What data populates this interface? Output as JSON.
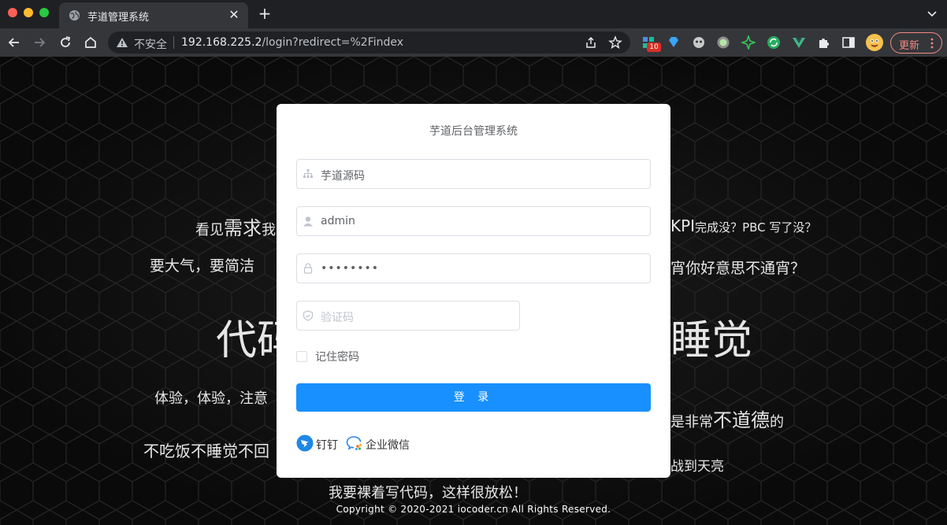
{
  "browser": {
    "tab_title": "芋道管理系统",
    "tab_close": "✕",
    "new_tab": "+",
    "security_label": "不安全",
    "url_host": "192.168.225.2",
    "url_path": "/login?redirect=%2Findex",
    "extension_badge": "10",
    "update_label": "更新"
  },
  "background": {
    "lines": [
      {
        "segments": [
          "看见",
          "需求",
          "我"
        ]
      },
      {
        "segments": [
          "KPI",
          "完成没？PBC 写了没？"
        ]
      },
      {
        "segments": [
          "要大气，要简洁"
        ]
      },
      {
        "segments": [
          "宵你好意思不通宵？"
        ]
      },
      {
        "segments": [
          "代码"
        ]
      },
      {
        "segments": [
          "睡觉"
        ]
      },
      {
        "segments": [
          "体验，体验，注意"
        ]
      },
      {
        "segments": [
          "是非常",
          "不道德",
          "的"
        ]
      },
      {
        "segments": [
          "不吃饭不睡觉不回"
        ]
      },
      {
        "segments": [
          "战到天亮"
        ]
      },
      {
        "segments": [
          "我要裸着写代码，这样很放松！"
        ]
      }
    ]
  },
  "login": {
    "title": "芋道后台管理系统",
    "tenant_value": "芋道源码",
    "username_value": "admin",
    "password_value": "••••••••",
    "captcha_placeholder": "验证码",
    "remember_label": "记住密码",
    "login_button": "登 录",
    "social": [
      {
        "label": "钉钉"
      },
      {
        "label": "企业微信"
      }
    ]
  },
  "footer": {
    "copyright": "Copyright © 2020-2021 iocoder.cn All Rights Reserved."
  },
  "colors": {
    "primary": "#1890ff",
    "chrome_dark": "#1f2023",
    "chrome_toolbar": "#35363a",
    "update_accent": "#f28b82"
  }
}
